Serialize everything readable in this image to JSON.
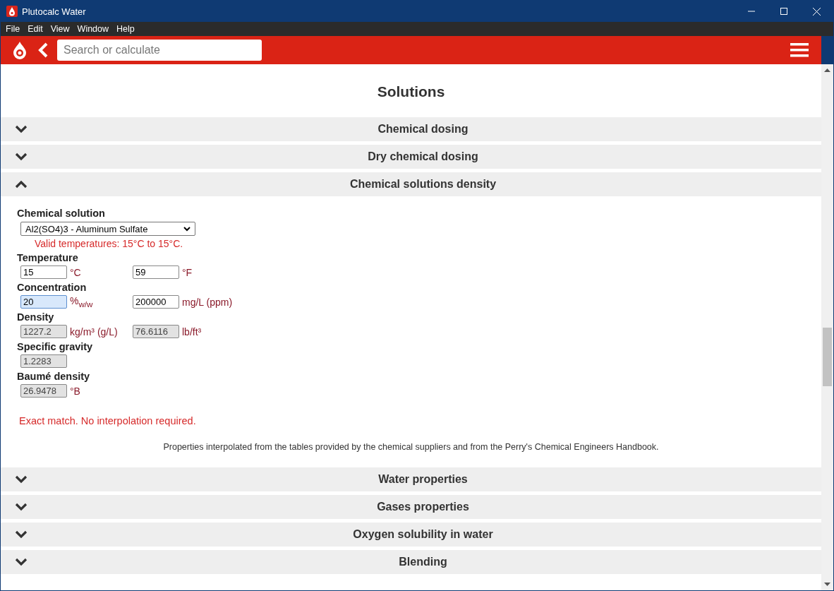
{
  "window": {
    "title": "Plutocalc Water"
  },
  "menu": [
    "File",
    "Edit",
    "View",
    "Window",
    "Help"
  ],
  "search": {
    "placeholder": "Search or calculate"
  },
  "page_title": "Solutions",
  "sections_before": [
    {
      "title": "Chemical dosing",
      "expanded": false
    },
    {
      "title": "Dry chemical dosing",
      "expanded": false
    },
    {
      "title": "Chemical solutions density",
      "expanded": true
    }
  ],
  "form": {
    "solution_label": "Chemical solution",
    "solution_value": "Al2(SO4)3 - Aluminum Sulfate",
    "valid_note": "Valid temperatures: 15°C to 15°C.",
    "groups": [
      {
        "label": "Temperature",
        "fields": [
          {
            "value": "15",
            "unit": "°C",
            "readonly": false,
            "focused": false
          },
          {
            "value": "59",
            "unit": "°F",
            "readonly": false,
            "focused": false
          }
        ]
      },
      {
        "label": "Concentration",
        "fields": [
          {
            "value": "20",
            "unit": "%$_{w/w}$",
            "readonly": false,
            "focused": true
          },
          {
            "value": "200000",
            "unit": "mg/L (ppm)",
            "readonly": false,
            "focused": false
          }
        ]
      },
      {
        "label": "Density",
        "fields": [
          {
            "value": "1227.2",
            "unit": "kg/m³ (g/L)",
            "readonly": true,
            "focused": false
          },
          {
            "value": "76.6116",
            "unit": "lb/ft³",
            "readonly": true,
            "focused": false
          }
        ]
      },
      {
        "label": "Specific gravity",
        "fields": [
          {
            "value": "1.2283",
            "readonly": true,
            "focused": false
          }
        ]
      },
      {
        "label": "Baumé density",
        "fields": [
          {
            "value": "26.9478",
            "unit": "°B",
            "readonly": true,
            "focused": false
          }
        ]
      }
    ],
    "match_note": "Exact match. No interpolation required.",
    "footnote": "Properties interpolated from the tables provided by the chemical suppliers and from the Perry's Chemical Engineers Handbook."
  },
  "sections_after": [
    {
      "title": "Water properties",
      "expanded": false
    },
    {
      "title": "Gases properties",
      "expanded": false
    },
    {
      "title": "Oxygen solubility in water",
      "expanded": false
    },
    {
      "title": "Blending",
      "expanded": false
    }
  ]
}
